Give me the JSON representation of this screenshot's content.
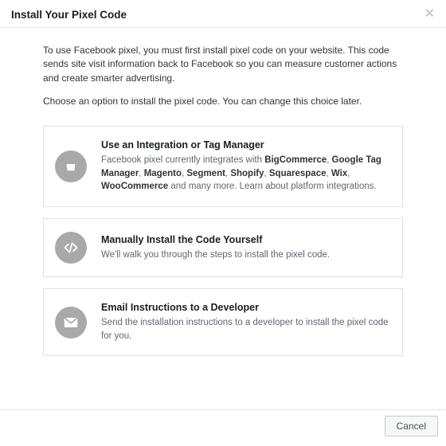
{
  "header": {
    "title": "Install Your Pixel Code"
  },
  "intro": "To use Facebook pixel, you must first install pixel code on your website. This code sends site visit information back to Facebook so you can measure customer actions and create smarter advertising.",
  "subintro": "Choose an option to install the pixel code. You can change this choice later.",
  "options": {
    "integration": {
      "title": "Use an Integration or Tag Manager",
      "desc_pre": "Facebook pixel currently integrates with ",
      "b1": "BigCommerce",
      "b2": "Google Tag Manager",
      "b3": "Magento",
      "b4": "Segment",
      "b5": "Shopify",
      "b6": "Squarespace",
      "b7": "Wix",
      "b8": "WooCommerce",
      "desc_post": " and many more. Learn about platform integrations."
    },
    "manual": {
      "title": "Manually Install the Code Yourself",
      "desc": "We'll walk you through the steps to install the pixel code."
    },
    "email": {
      "title": "Email Instructions to a Developer",
      "desc": "Send the installation instructions to a developer to install the pixel code for you."
    }
  },
  "footer": {
    "cancel": "Cancel"
  }
}
